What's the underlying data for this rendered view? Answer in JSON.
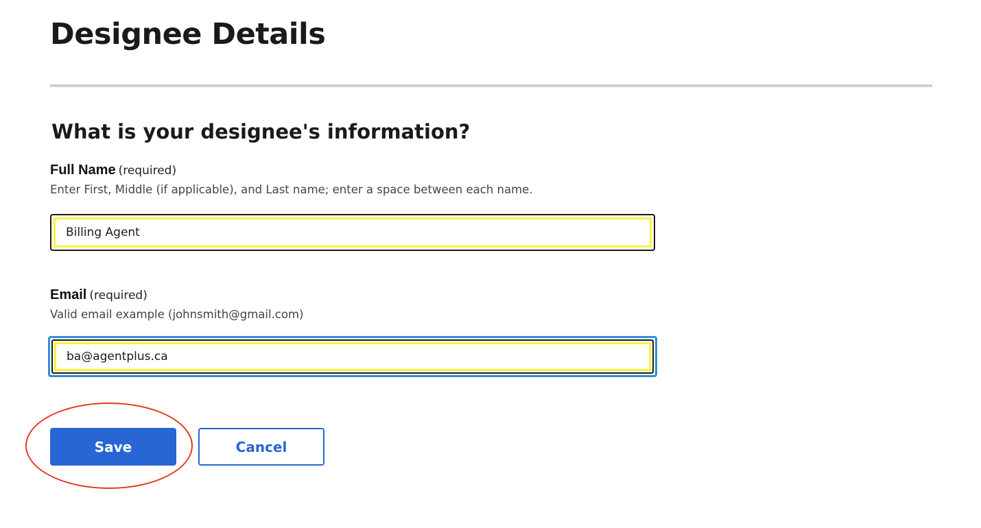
{
  "page": {
    "title": "Designee Details"
  },
  "form": {
    "heading": "What is your designee's information?",
    "full_name": {
      "label": "Full Name",
      "required_text": "(required)",
      "hint": "Enter First, Middle (if applicable), and Last name; enter a space between each name.",
      "value": "Billing Agent"
    },
    "email": {
      "label": "Email",
      "required_text": "(required)",
      "hint": "Valid email example (johnsmith@gmail.com)",
      "value": "ba@agentplus.ca"
    }
  },
  "actions": {
    "save_label": "Save",
    "cancel_label": "Cancel"
  },
  "colors": {
    "primary": "#2766d4",
    "focus_ring": "#2d8fd5",
    "highlight": "#f5f53a",
    "annotation": "#e03a1e",
    "divider": "#cfcfcf"
  }
}
